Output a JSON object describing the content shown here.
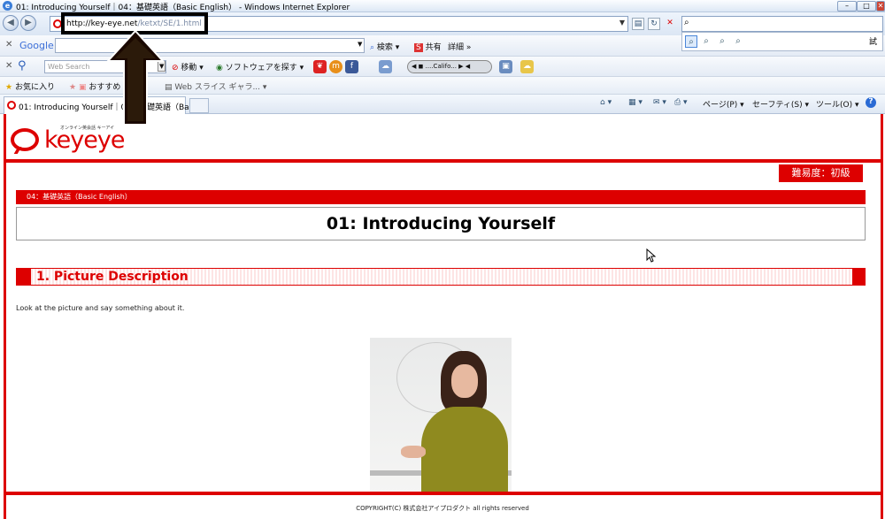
{
  "window": {
    "title": "01: Introducing Yourself｜04：基礎英語（Basic English） - Windows Internet Explorer",
    "min": "–",
    "max": "□",
    "close": "✕"
  },
  "nav": {
    "back": "◀",
    "forward": "▶",
    "url_host": "http://key-eye.net",
    "url_path": "/ketxt/SE/1.html",
    "search_value": "",
    "compat": "▤",
    "refresh": "↻",
    "stop": "✕"
  },
  "google": {
    "label": "Google",
    "search_btn": "検索",
    "share": "共有",
    "more": "詳細 »"
  },
  "biglobe": {
    "placeholder": "Web Search",
    "move": "移動",
    "software": "ソフトウェアを探す",
    "weather": "....Califo..."
  },
  "favorites": {
    "fav": "お気に入り",
    "suggest": "おすすめ",
    "webslice": "Web スライス ギャラ..."
  },
  "tab": {
    "title": "01: Introducing Yourself｜04：基礎英語（Ba..."
  },
  "cmdbar": {
    "page": "ページ(P)",
    "safety": "セーフティ(S)",
    "tools": "ツール(O)",
    "help": "?"
  },
  "search_popup": {
    "extra": "試"
  },
  "page": {
    "logo_word": "keyeye",
    "logo_tag": "オンライン英会話 キーアイ",
    "difficulty": "難易度：初級",
    "breadcrumb": "04：基礎英語（Basic English）",
    "title": "01: Introducing Yourself",
    "section": "1. Picture Description",
    "instruction": "Look at the picture and say something about it.",
    "copyright": "COPYRIGHT(C) 株式会社アイプロダクト all rights reserved"
  },
  "colors": {
    "brand_red": "#dd0000",
    "ie_blue": "#3b7ed9"
  }
}
